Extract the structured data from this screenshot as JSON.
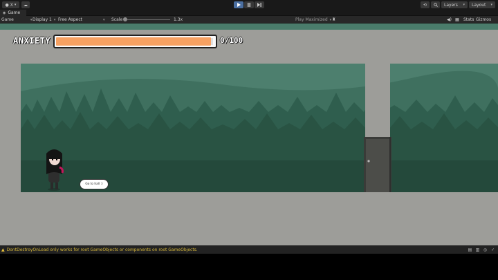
{
  "toolbar": {
    "account_label": "X",
    "play_icon": "play-icon",
    "pause_icon": "pause-icon",
    "step_icon": "step-icon",
    "layers_label": "Layers",
    "layout_label": "Layout"
  },
  "tab": {
    "label": "Game"
  },
  "game_bar": {
    "view_mode": "Game",
    "display": "Display 1",
    "aspect": "Free Aspect",
    "scale_label": "Scale",
    "scale_value": "1.3x",
    "play_mode": "Play Maximized",
    "stats_label": "Stats",
    "gizmos_label": "Gizmos"
  },
  "game": {
    "anxiety_label": "ANXIETY",
    "anxiety_value_text": "0/100",
    "anxiety_fill_fraction": 0.98,
    "speech_text": "Go to hall :)"
  },
  "status": {
    "message": "DontDestroyOnLoad only works for root GameObjects or components on root GameObjects."
  },
  "colors": {
    "anxiety_fill": "#f6a162",
    "forest_sky": "#4d7f6e",
    "forest_mid": "#2b5748",
    "forest_dark": "#214638",
    "warning": "#d6b73a",
    "play_active": "#4b6fa1"
  }
}
